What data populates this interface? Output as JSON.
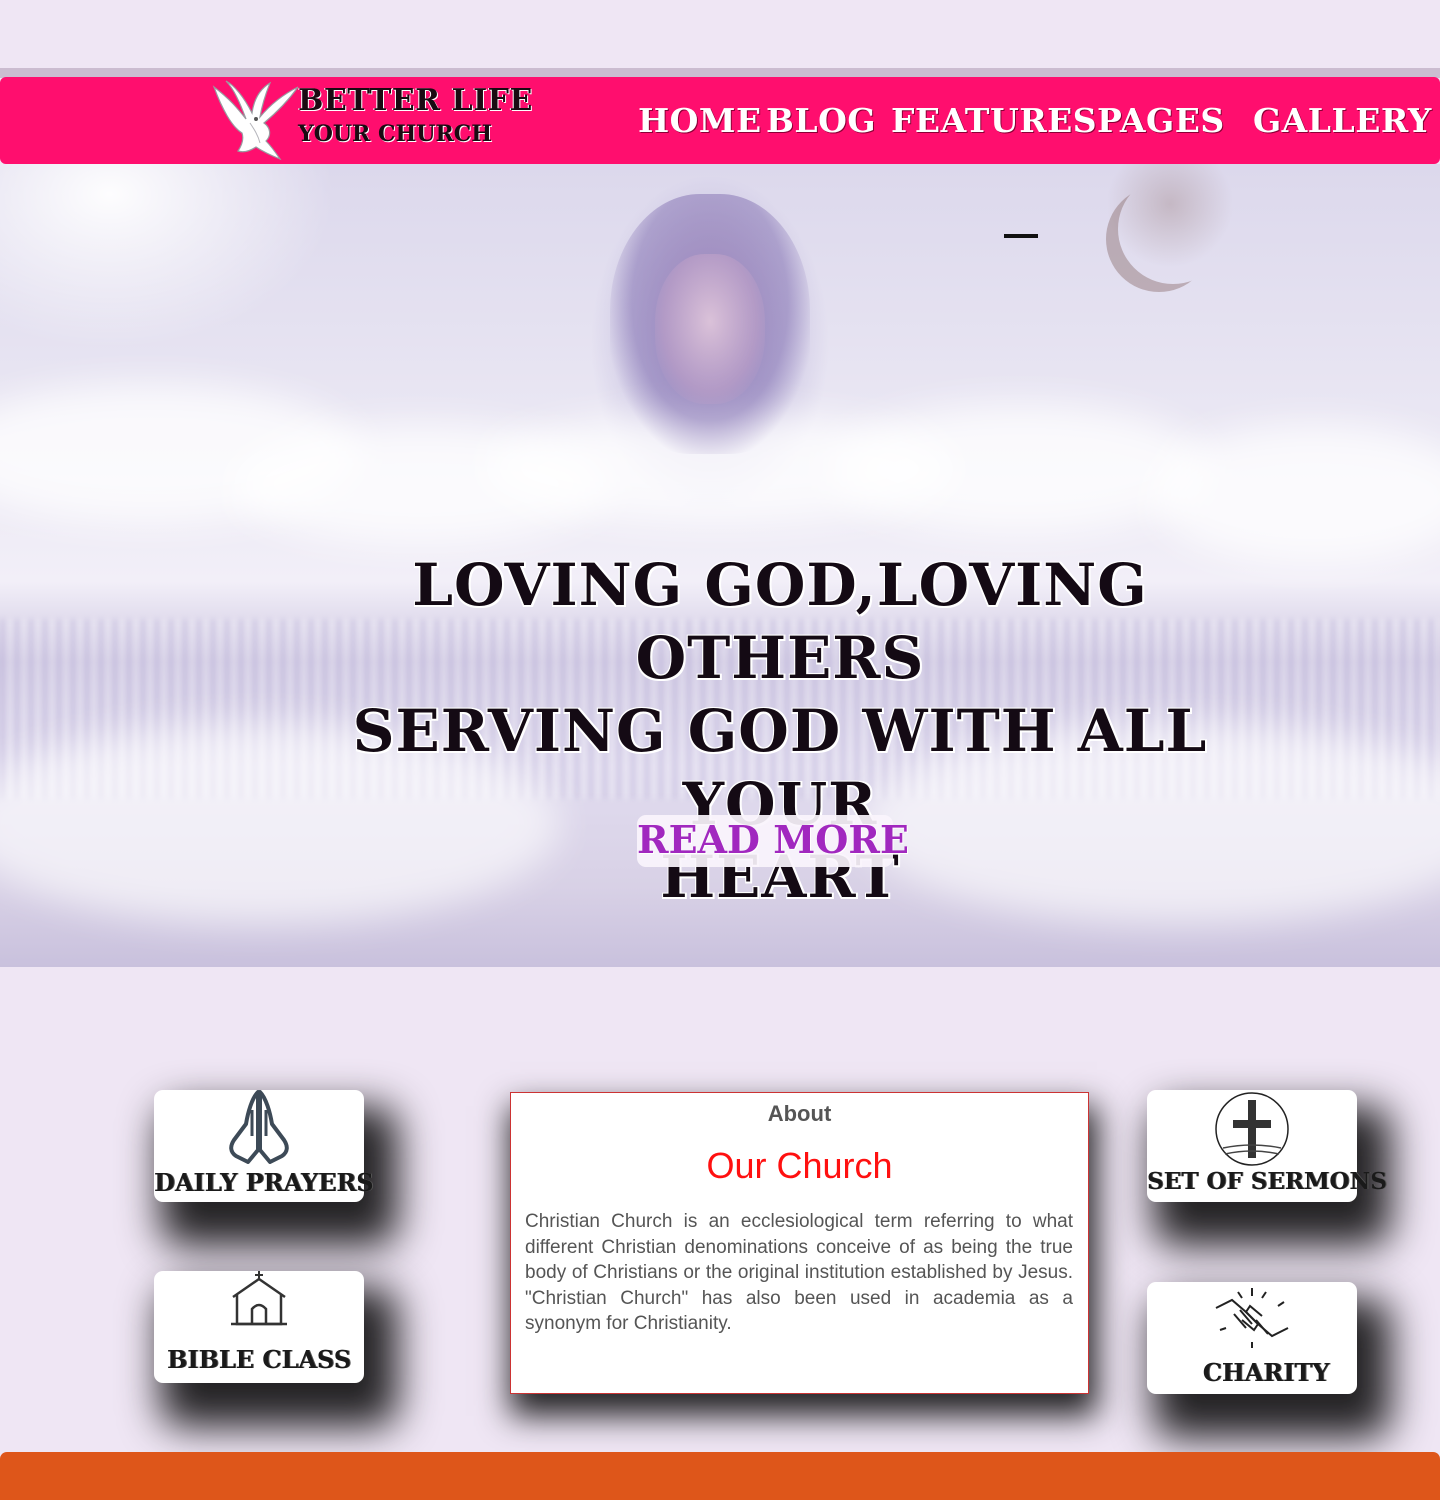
{
  "header": {
    "brand_name": "BETTER LIFE",
    "brand_tagline": "YOUR CHURCH",
    "nav": [
      {
        "label": "HOME"
      },
      {
        "label": "BLOG"
      },
      {
        "label": "FEATURES"
      },
      {
        "label": "PAGES"
      },
      {
        "label": "GALLERY"
      }
    ]
  },
  "hero": {
    "title_line1": "LOVING GOD,LOVING OTHERS",
    "title_line2": "SERVING GOD WITH ALL YOUR",
    "title_line3": "HEART",
    "button_label": "READ MORE"
  },
  "features": {
    "daily_prayers": "DAILY PRAYERS",
    "bible_class": "BIBLE CLASS",
    "set_of_sermons": "SET OF SERMONS",
    "charity": "CHARITY"
  },
  "about": {
    "kicker": "About",
    "title": "Our Church",
    "body": "Christian Church is an ecclesiological term referring to what different Christian denominations conceive of as being the true body of Christians or the original institution established by Jesus. \"Christian Church\" has also been used in academia as a synonym for Christianity."
  },
  "colors": {
    "nav_bg": "#ff0e6e",
    "page_bg": "#efe6f4",
    "accent_button_text": "#a128bf",
    "about_title": "#ff1010",
    "footer_bg": "#de561a"
  },
  "icons": {
    "brand": "dove-icon",
    "daily_prayers": "praying-hands-icon",
    "bible_class": "church-icon",
    "set_of_sermons": "cross-icon",
    "charity": "helping-hands-icon"
  }
}
